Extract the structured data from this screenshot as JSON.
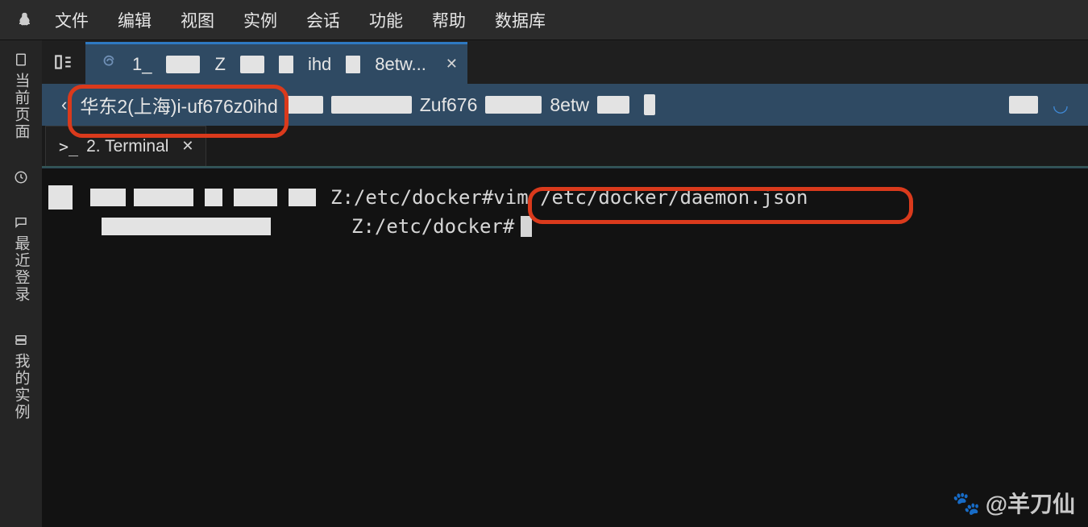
{
  "menu": {
    "items": [
      "文件",
      "编辑",
      "视图",
      "实例",
      "会话",
      "功能",
      "帮助",
      "数据库"
    ]
  },
  "leftbar": {
    "items": [
      {
        "label": "当前页面",
        "icon": "page-icon"
      },
      {
        "label": "",
        "icon": "clock-icon"
      },
      {
        "label": "最近登录",
        "icon": "chat-icon"
      },
      {
        "label": "我的实例",
        "icon": "server-icon"
      }
    ]
  },
  "top_tab": {
    "seg1": "1_",
    "seg2": "Z",
    "seg3": "ihd",
    "seg4": "8etw..."
  },
  "breadcrumb": {
    "text_main": "华东2(上海)i-uf676z0ihd",
    "frag1": "Zuf676",
    "frag2": "8etw"
  },
  "terminal_tab": {
    "label": "2. Terminal"
  },
  "terminal": {
    "line1": {
      "partA": "Z:/etc/docker#",
      "partB": " vim /etc/docker/daemon.json"
    },
    "line2": {
      "partA": "Z:/etc/docker#"
    }
  },
  "watermark": "@羊刀仙"
}
